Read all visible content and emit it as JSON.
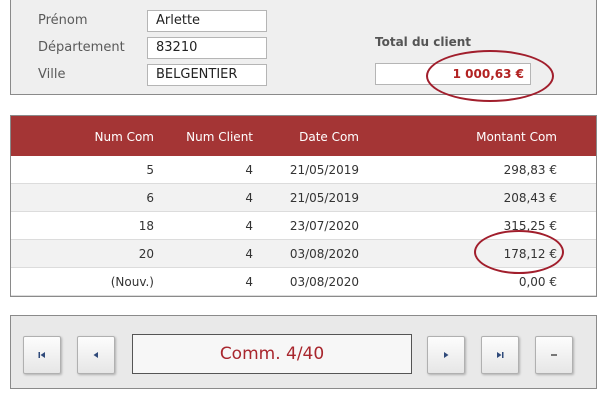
{
  "client": {
    "prenom_label": "Prénom",
    "prenom_value": "Arlette",
    "departement_label": "Département",
    "departement_value": "83210",
    "ville_label": "Ville",
    "ville_value": "BELGENTIER",
    "total_label": "Total du client",
    "total_value": "1 000,63 €"
  },
  "orders": {
    "columns": [
      "Num Com",
      "Num Client",
      "Date Com",
      "Montant Com"
    ],
    "rows": [
      [
        "5",
        "4",
        "21/05/2019",
        "298,83 €"
      ],
      [
        "6",
        "4",
        "21/05/2019",
        "208,43 €"
      ],
      [
        "18",
        "4",
        "23/07/2020",
        "315,25 €"
      ],
      [
        "20",
        "4",
        "03/08/2020",
        "178,12 €"
      ],
      [
        "(Nouv.)",
        "4",
        "03/08/2020",
        "0,00 €"
      ]
    ]
  },
  "navigation": {
    "record_text": "Comm. 4/40",
    "buttons": [
      "first-record-icon",
      "previous-record-icon",
      "next-record-icon",
      "last-record-icon",
      "new-record-icon"
    ]
  },
  "colors": {
    "header_bg": "#a43535",
    "accent_red": "#a8262d",
    "highlight_ellipse": "#a11e2c"
  }
}
